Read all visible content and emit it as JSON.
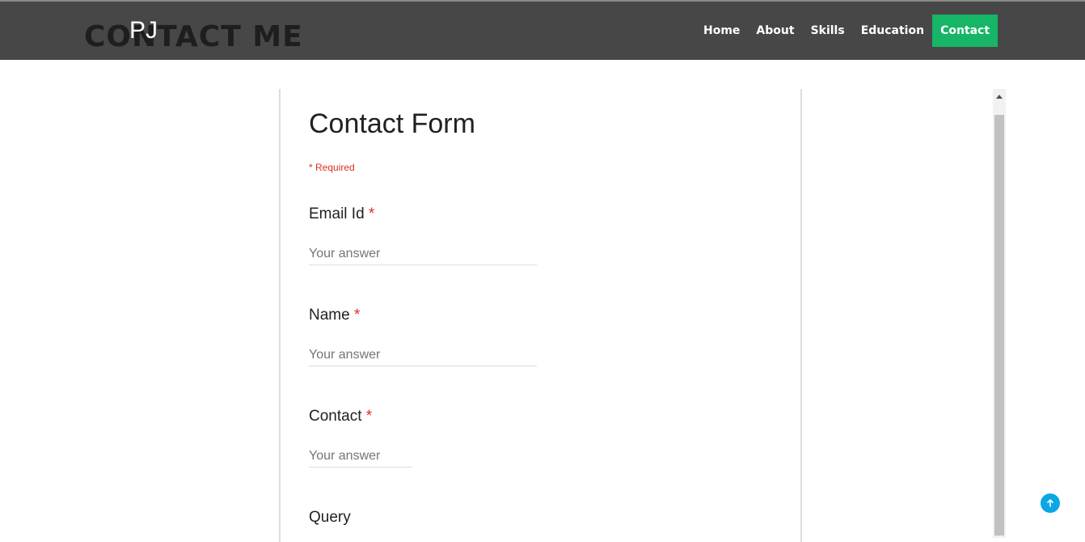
{
  "header": {
    "background_title": "CONTACT ME",
    "brand": "PJ",
    "nav": [
      "Home",
      "About",
      "Skills",
      "Education",
      "Contact"
    ],
    "active_nav": "Contact",
    "active_color": "#17b566"
  },
  "form": {
    "title": "Contact Form",
    "required_note": "* Required",
    "questions": [
      {
        "label": "Email Id",
        "required": "*",
        "placeholder": "Your answer"
      },
      {
        "label": "Name",
        "required": "*",
        "placeholder": "Your answer"
      },
      {
        "label": "Contact",
        "required": "*",
        "placeholder": "Your answer"
      },
      {
        "label": "Query"
      }
    ]
  },
  "icons": {
    "scroll_to_top": "arrow-up-icon",
    "scroll_up": "triangle-up-icon"
  }
}
